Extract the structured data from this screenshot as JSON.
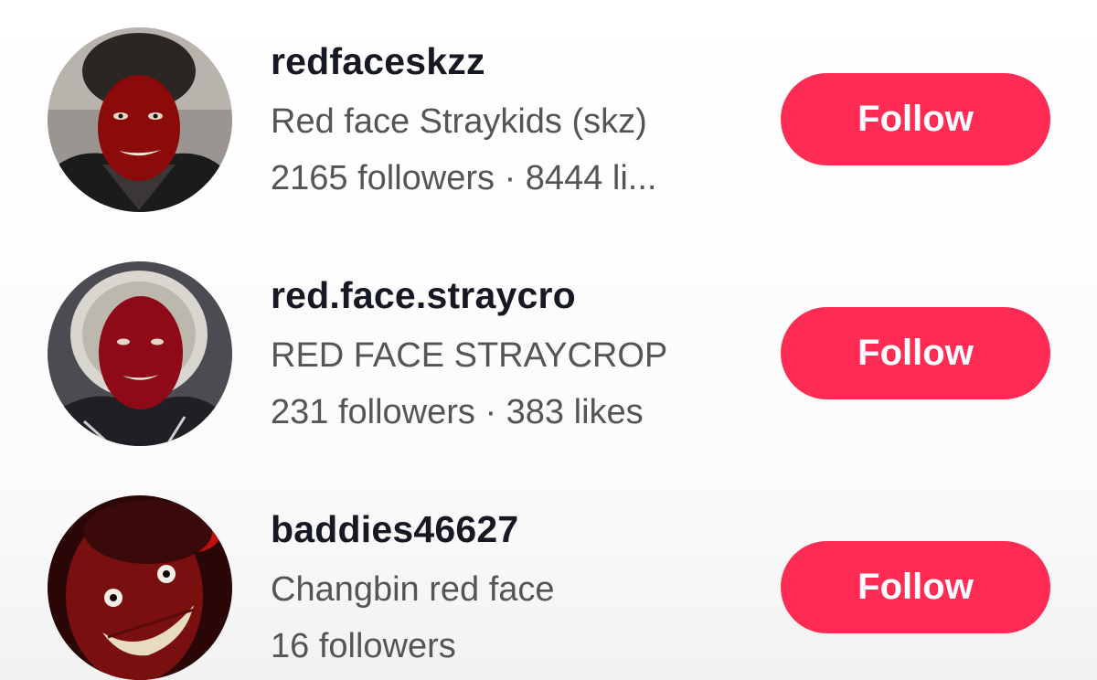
{
  "results": [
    {
      "username": "redfaceskzz",
      "nickname": "Red face Straykids (skz)",
      "stats": "2165 followers · 8444 li...",
      "follow_label": "Follow"
    },
    {
      "username": "red.face.straycro",
      "nickname": "RED FACE STRAYCROP",
      "stats": "231 followers · 383 likes",
      "follow_label": "Follow"
    },
    {
      "username": "baddies46627",
      "nickname": "Changbin red face",
      "stats": "16 followers",
      "follow_label": "Follow"
    }
  ],
  "colors": {
    "follow_button": "#fe2c55",
    "username_text": "#161823",
    "secondary_text": "#545559"
  }
}
